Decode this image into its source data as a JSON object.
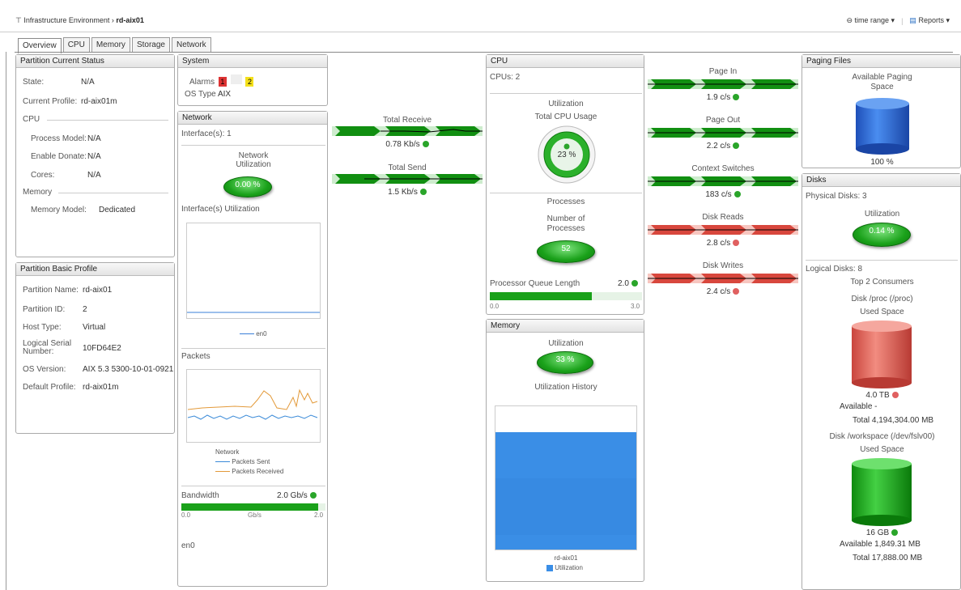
{
  "breadcrumb": {
    "parent": "Infrastructure Environment",
    "current": "rd-aix01"
  },
  "topright": {
    "time_range": "time range",
    "reports": "Reports"
  },
  "tabs": [
    "Overview",
    "CPU",
    "Memory",
    "Storage",
    "Network"
  ],
  "status": {
    "title": "Partition Current Status",
    "state_lbl": "State:",
    "state": "N/A",
    "profile_lbl": "Current Profile:",
    "profile": "rd-aix01m",
    "cpu": "CPU",
    "pm_lbl": "Process Model:",
    "pm": "N/A",
    "ed_lbl": "Enable Donate:",
    "ed": "N/A",
    "cores_lbl": "Cores:",
    "cores": "N/A",
    "mem": "Memory",
    "mm_lbl": "Memory Model:",
    "mm": "Dedicated"
  },
  "basic": {
    "title": "Partition Basic Profile",
    "name_lbl": "Partition Name:",
    "name": "rd-aix01",
    "id_lbl": "Partition ID:",
    "id": "2",
    "host_lbl": "Host Type:",
    "host": "Virtual",
    "serial_lbl1": "Logical Serial",
    "serial_lbl2": "Number:",
    "serial": "10FD64E2",
    "os_lbl": "OS Version:",
    "os": "AIX 5.3 5300-10-01-0921",
    "def_lbl": "Default Profile:",
    "def": "rd-aix01m"
  },
  "system": {
    "title": "System",
    "alarms_lbl": "Alarms",
    "alarm1": "1",
    "alarm2": "2",
    "os_lbl": "OS Type",
    "os": "AIX"
  },
  "network": {
    "title": "Network",
    "interfaces": "Interface(s): 1",
    "util_lbl1": "Network",
    "util_lbl2": "Utilization",
    "util": "0.00 %",
    "iface_util": "Interface(s) Utilization",
    "legend_en0": "en0",
    "packets": "Packets",
    "pk_legend_title": "Network",
    "pk_sent": "Packets Sent",
    "pk_recv": "Packets Received",
    "bw_lbl": "Bandwidth",
    "bw_val": "2.0 Gb/s",
    "bw_min": "0.0",
    "bw_unit": "Gb/s",
    "bw_max": "2.0",
    "en0": "en0",
    "bw_fill": 0.95
  },
  "flows_mid": [
    {
      "label": "Total Receive",
      "value": "0.78 Kb/s",
      "status": "ok"
    },
    {
      "label": "Total Send",
      "value": "1.5 Kb/s",
      "status": "ok"
    }
  ],
  "cpu": {
    "title": "CPU",
    "cpus": "CPUs: 2",
    "util_hdr": "Utilization",
    "total_lbl": "Total CPU Usage",
    "total": "23 %",
    "proc_hdr": "Processes",
    "num_lbl1": "Number of",
    "num_lbl2": "Processes",
    "num": "52",
    "pql_lbl": "Processor Queue Length",
    "pql_val": "2.0",
    "pql_min": "0.0",
    "pql_max": "3.0",
    "pql_fill": 0.67
  },
  "memory": {
    "title": "Memory",
    "util_hdr": "Utilization",
    "util": "33 %",
    "hist_lbl": "Utilization History",
    "legend_title": "rd-aix01",
    "legend": "Utilization"
  },
  "flows_right": [
    {
      "label": "Page In",
      "value": "1.9 c/s",
      "status": "ok",
      "color": "green"
    },
    {
      "label": "Page Out",
      "value": "2.2 c/s",
      "status": "ok",
      "color": "green"
    },
    {
      "label": "Context Switches",
      "value": "183 c/s",
      "status": "ok",
      "color": "green"
    },
    {
      "label": "Disk Reads",
      "value": "2.8 c/s",
      "status": "bad",
      "color": "red"
    },
    {
      "label": "Disk Writes",
      "value": "2.4 c/s",
      "status": "bad",
      "color": "red"
    }
  ],
  "paging": {
    "title": "Paging Files",
    "avail_lbl1": "Available Paging",
    "avail_lbl2": "Space",
    "pct": "100 %"
  },
  "disks": {
    "title": "Disks",
    "physical": "Physical Disks: 3",
    "util_hdr": "Utilization",
    "util": "0.14 %",
    "logical": "Logical Disks: 8",
    "top": "Top 2 Consumers",
    "d1_name": "Disk /proc (/proc)",
    "d1_used": "Used Space",
    "d1_size": "4.0 TB",
    "d1_avail": "Available -",
    "d1_total": "Total 4,194,304.00 MB",
    "d2_name": "Disk /workspace (/dev/fslv00)",
    "d2_used": "Used Space",
    "d2_size": "16 GB",
    "d2_avail": "Available 1,849.31 MB",
    "d2_total": "Total 17,888.00 MB"
  },
  "colors": {
    "green": "#1aa11a",
    "red": "#e05a50",
    "blue": "#2f7fe0"
  }
}
